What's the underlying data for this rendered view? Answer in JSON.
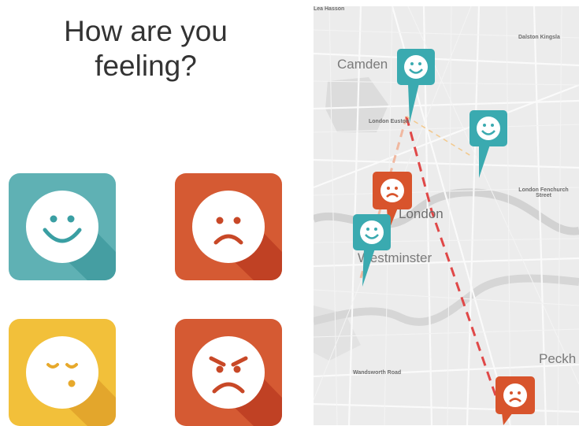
{
  "question": {
    "line1": "How are you",
    "line2": "feeling?"
  },
  "moods": [
    {
      "name": "happy",
      "icon": "happy-face-icon",
      "color": "#58aeb1"
    },
    {
      "name": "sad",
      "icon": "sad-face-icon",
      "color": "#d45a30"
    },
    {
      "name": "sleepy",
      "icon": "sleepy-face-icon",
      "color": "#f2bf35"
    },
    {
      "name": "angry",
      "icon": "angry-face-icon",
      "color": "#d45a30"
    }
  ],
  "map": {
    "labels": {
      "camden": "Camden",
      "dalston": "Dalston Kingsla",
      "london_euston": "London Euston",
      "london_fenchurch": "London Fenchurch Street",
      "london": "London",
      "westminster": "Westminster",
      "peckham": "Peckh",
      "wandsworth": "Wandsworth Road",
      "top_clip": "Lea Hasson"
    },
    "pins": [
      {
        "mood": "happy",
        "color": "#3aaab0"
      },
      {
        "mood": "happy",
        "color": "#3aaab0"
      },
      {
        "mood": "sad",
        "color": "#d8542c"
      },
      {
        "mood": "happy",
        "color": "#3aaab0"
      },
      {
        "mood": "sad",
        "color": "#d8542c"
      }
    ],
    "route_color": "#e04848"
  }
}
